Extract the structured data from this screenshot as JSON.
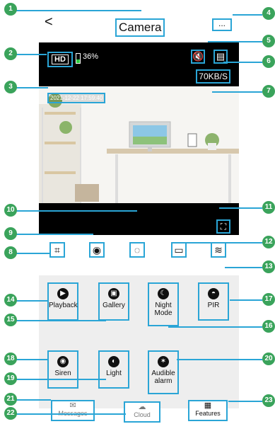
{
  "header": {
    "back": "<",
    "title": "Camera",
    "more": "..."
  },
  "video": {
    "hd": "HD",
    "battery": "36%",
    "speed": "70KB/S",
    "timestamp": "2021-12-22 17:59:40"
  },
  "tiles": {
    "playback": "Playback",
    "gallery": "Gallery",
    "night_mode": "Night Mode",
    "pir": "PIR",
    "siren": "Siren",
    "light": "Light",
    "audible_alarm": "Audible alarm"
  },
  "bottom": {
    "messages": "Messages",
    "cloud": "Cloud",
    "features": "Features"
  },
  "callouts": [
    "1",
    "2",
    "3",
    "4",
    "5",
    "6",
    "7",
    "8",
    "9",
    "10",
    "11",
    "12",
    "13",
    "14",
    "15",
    "16",
    "17",
    "18",
    "19",
    "20",
    "21",
    "22",
    "23"
  ]
}
